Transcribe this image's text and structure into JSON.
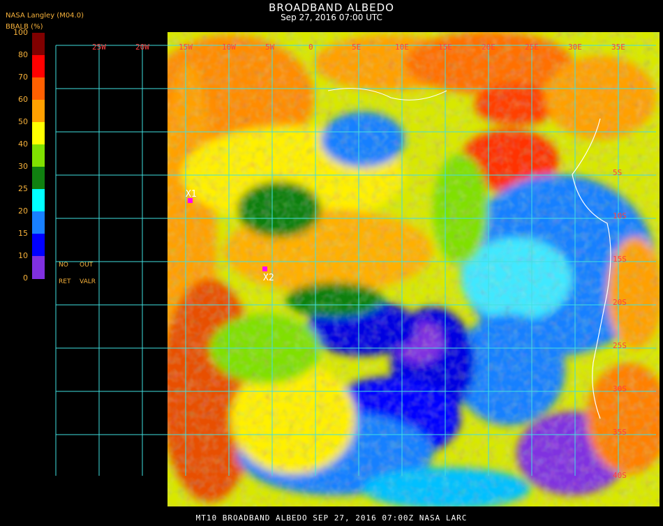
{
  "header": {
    "title": "BROADBAND ALBEDO",
    "subtitle": "Sep 27, 2016 07:00 UTC",
    "org": "NASA Langley (M04.0)",
    "unit": "BBALB (%)"
  },
  "legend": {
    "stops": [
      {
        "label": "100",
        "color": "#800000"
      },
      {
        "label": "80",
        "color": "#ff0000"
      },
      {
        "label": "70",
        "color": "#ff6000"
      },
      {
        "label": "60",
        "color": "#ffa000"
      },
      {
        "label": "50",
        "color": "#ffff00"
      },
      {
        "label": "40",
        "color": "#80e000"
      },
      {
        "label": "30",
        "color": "#108010"
      },
      {
        "label": "25",
        "color": "#00ffff"
      },
      {
        "label": "20",
        "color": "#1880ff"
      },
      {
        "label": "15",
        "color": "#0000ff"
      },
      {
        "label": "10",
        "color": "#8030e0"
      },
      {
        "label": "0",
        "color": ""
      }
    ],
    "no_label": "NO",
    "out_label": "OUT",
    "ret_label": "RET",
    "valr_label": "VALR"
  },
  "map": {
    "lon_labels_visible": [
      "25W",
      "20W",
      "15W",
      "10W",
      "5W",
      "0",
      "5E",
      "10E",
      "15E",
      "20E",
      "25E",
      "30E",
      "35E"
    ],
    "lat_labels_visible": [
      "5S",
      "10S",
      "15S",
      "20S",
      "25S",
      "30S",
      "35S",
      "40S"
    ],
    "markers": [
      {
        "label": "X1",
        "color": "#ff00ff"
      },
      {
        "label": "X2",
        "color": "#ff00ff"
      }
    ],
    "grid_color": "#40e0e0",
    "lon_label_color": "#ff4040"
  },
  "footer": {
    "text": "MT10   BROADBAND ALBEDO   SEP 27, 2016 07:00Z   NASA LARC"
  }
}
